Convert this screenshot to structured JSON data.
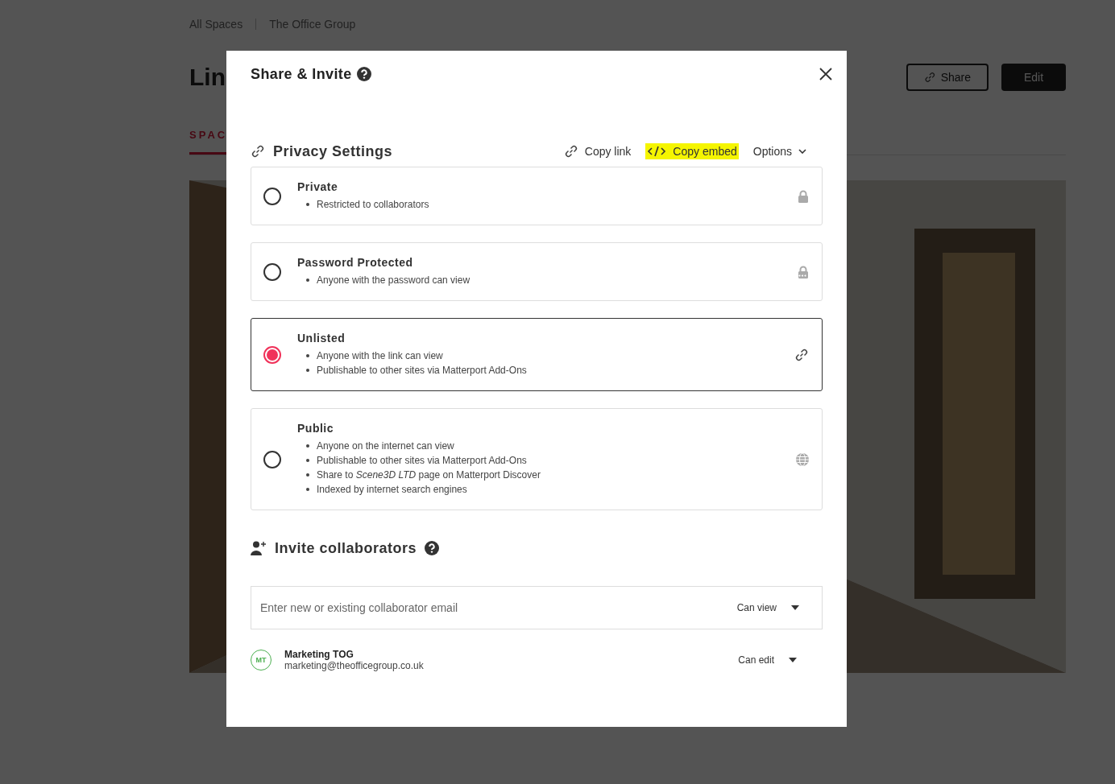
{
  "background_page": {
    "breadcrumbs": [
      "All Spaces",
      "The Office Group"
    ],
    "title": "Lin",
    "tabs": [
      {
        "label": "SPAC",
        "selected": true
      }
    ],
    "buttons": [
      {
        "label": "Share",
        "kind": "outline"
      },
      {
        "label": "Edit",
        "kind": "filled"
      }
    ],
    "media": {
      "kind": "picture"
    }
  },
  "dialog": {
    "title": "Share & Invite",
    "privacy": {
      "heading": "Privacy Settings",
      "actions": [
        {
          "kind": "link",
          "label": "Copy link",
          "highlighted": false
        },
        {
          "kind": "embed",
          "label": "Copy embed",
          "highlighted": true
        },
        {
          "kind": "menu",
          "label": "Options",
          "highlighted": false
        }
      ],
      "options": [
        {
          "title": "Private",
          "bullets": [
            "Restricted to collaborators"
          ],
          "selected": false,
          "kind": "lock"
        },
        {
          "title": "Password Protected",
          "bullets": [
            "Anyone with the password can view"
          ],
          "selected": false,
          "kind": "password"
        },
        {
          "title": "Unlisted",
          "bullets": [
            "Anyone with the link can view",
            "Publishable to other sites via Matterport Add-Ons"
          ],
          "selected": true,
          "kind": "link"
        },
        {
          "title": "Public",
          "bullets": [
            "Anyone on the internet can view",
            "Publishable to other sites via Matterport Add-Ons",
            "Share to *Scene3D LTD* page on Matterport Discover",
            "Indexed by internet search engines"
          ],
          "selected": false,
          "kind": "globe"
        }
      ]
    },
    "invite": {
      "heading": "Invite collaborators",
      "email_field": {
        "placeholder": "Enter new or existing collaborator email",
        "permission": "Can view"
      },
      "collaborators": [
        {
          "initials": "MT",
          "name": "Marketing TOG",
          "email": "marketing@theofficegroup.co.uk",
          "permission": "Can edit"
        }
      ]
    }
  }
}
